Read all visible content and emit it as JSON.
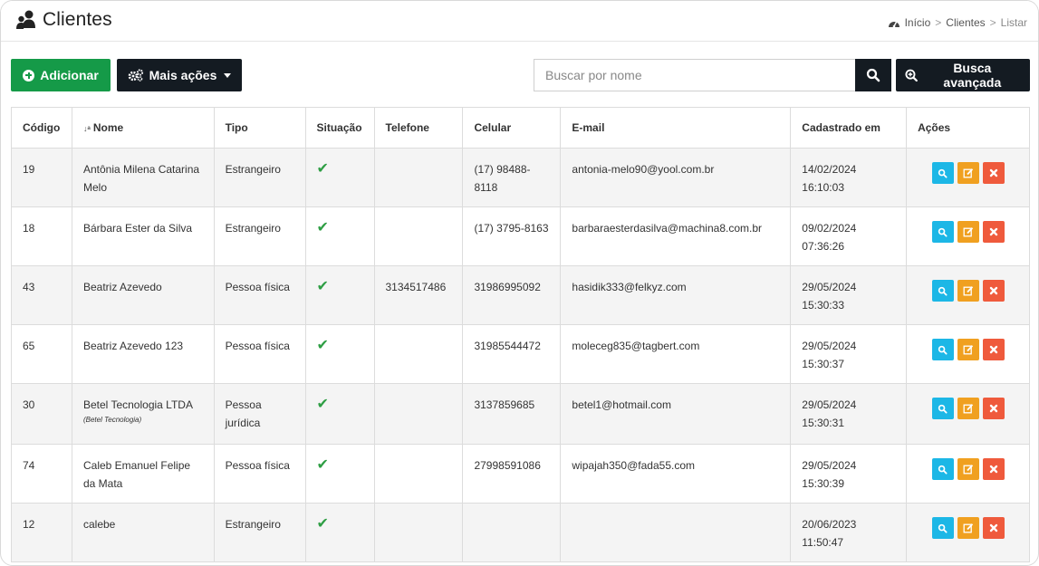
{
  "header": {
    "title": "Clientes",
    "breadcrumb": [
      "Início",
      "Clientes",
      "Listar"
    ]
  },
  "toolbar": {
    "add_label": "Adicionar",
    "more_label": "Mais ações",
    "search_placeholder": "Buscar por nome",
    "advanced_label": "Busca avançada"
  },
  "table": {
    "columns": [
      "Código",
      "Nome",
      "Tipo",
      "Situação",
      "Telefone",
      "Celular",
      "E-mail",
      "Cadastrado em",
      "Ações"
    ],
    "rows": [
      {
        "codigo": "19",
        "nome": "Antônia Milena Catarina Melo",
        "nome_sub": "",
        "tipo": "Estrangeiro",
        "situacao": "✔",
        "telefone": "",
        "celular": "(17) 98488-8118",
        "email": "antonia-melo90@yool.com.br",
        "cadastro": "14/02/2024 16:10:03"
      },
      {
        "codigo": "18",
        "nome": "Bárbara Ester da Silva",
        "nome_sub": "",
        "tipo": "Estrangeiro",
        "situacao": "✔",
        "telefone": "",
        "celular": "(17) 3795-8163",
        "email": "barbaraesterdasilva@machina8.com.br",
        "cadastro": "09/02/2024 07:36:26"
      },
      {
        "codigo": "43",
        "nome": "Beatriz Azevedo",
        "nome_sub": "",
        "tipo": "Pessoa física",
        "situacao": "✔",
        "telefone": "3134517486",
        "celular": "31986995092",
        "email": "hasidik333@felkyz.com",
        "cadastro": "29/05/2024 15:30:33"
      },
      {
        "codigo": "65",
        "nome": "Beatriz Azevedo 123",
        "nome_sub": "",
        "tipo": "Pessoa física",
        "situacao": "✔",
        "telefone": "",
        "celular": "31985544472",
        "email": "moleceg835@tagbert.com",
        "cadastro": "29/05/2024 15:30:37"
      },
      {
        "codigo": "30",
        "nome": "Betel Tecnologia LTDA",
        "nome_sub": "(Betel Tecnologia)",
        "tipo": "Pessoa jurídica",
        "situacao": "✔",
        "telefone": "",
        "celular": "3137859685",
        "email": "betel1@hotmail.com",
        "cadastro": "29/05/2024 15:30:31"
      },
      {
        "codigo": "74",
        "nome": "Caleb Emanuel Felipe da Mata",
        "nome_sub": "",
        "tipo": "Pessoa física",
        "situacao": "✔",
        "telefone": "",
        "celular": "27998591086",
        "email": "wipajah350@fada55.com",
        "cadastro": "29/05/2024 15:30:39"
      },
      {
        "codigo": "12",
        "nome": "calebe",
        "nome_sub": "",
        "tipo": "Estrangeiro",
        "situacao": "✔",
        "telefone": "",
        "celular": "",
        "email": "",
        "cadastro": "20/06/2023 11:50:47"
      }
    ]
  },
  "colors": {
    "add_button": "#159a48",
    "dark_button": "#141b22",
    "view_action": "#1cb7e6",
    "edit_action": "#f0a020",
    "delete_action": "#ef5a3c",
    "check": "#2e9e44"
  },
  "icons": {
    "title": "users-icon",
    "breadcrumb_home": "dashboard-icon",
    "add": "plus-circle-icon",
    "more": "gears-icon",
    "search": "search-icon",
    "advanced": "search-plus-icon",
    "sort": "sort-alpha-icon",
    "row_actions": [
      "view-icon",
      "edit-icon",
      "delete-icon"
    ]
  }
}
